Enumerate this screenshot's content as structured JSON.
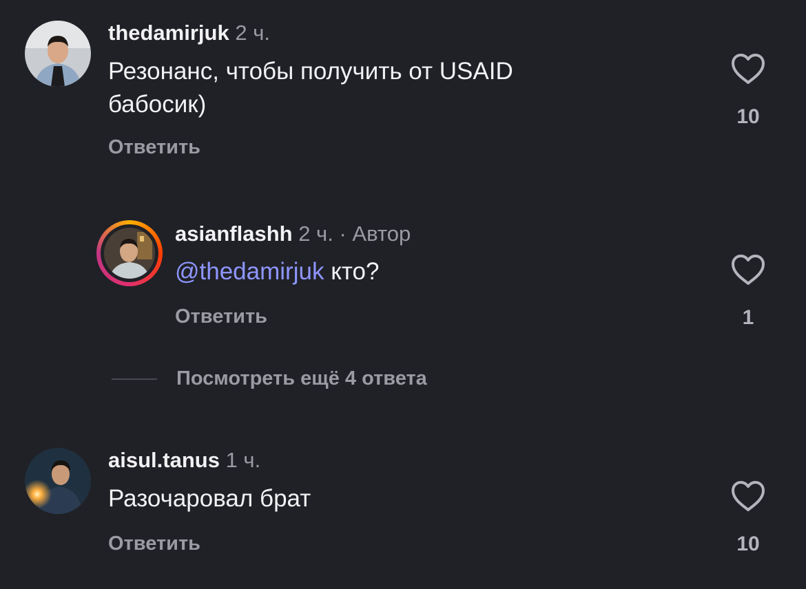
{
  "comments": [
    {
      "username": "thedamirjuk",
      "time": "2 ч.",
      "text_line1": "Резонанс, чтобы получить от USAID",
      "text_line2": "бабосик)",
      "reply_label": "Ответить",
      "like_icon": "heart-outline-icon",
      "likes": "10"
    },
    {
      "username": "asianflashh",
      "time": "2 ч.",
      "separator": "·",
      "author_badge": "Автор",
      "mention": "@thedamirjuk",
      "text": "кто?",
      "reply_label": "Ответить",
      "like_icon": "heart-outline-icon",
      "likes": "1"
    },
    {
      "username": "aisul.tanus",
      "time": "1 ч.",
      "text": "Разочаровал брат",
      "reply_label": "Ответить",
      "like_icon": "heart-outline-icon",
      "likes": "10"
    }
  ],
  "view_more": {
    "label": "Посмотреть ещё 4 ответа"
  },
  "colors": {
    "background": "#202126",
    "primary_text": "#f2f2f5",
    "secondary_text": "#9a9ba3",
    "mention": "#8e96ff"
  }
}
